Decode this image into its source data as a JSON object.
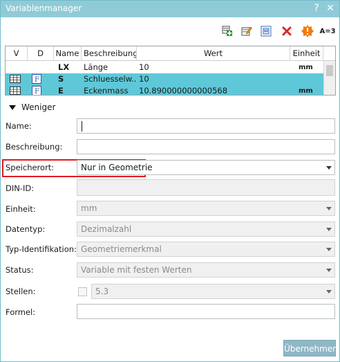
{
  "window": {
    "title": "Variablenmanager"
  },
  "titlebar_buttons": {
    "help": "?",
    "close": "✕"
  },
  "toolbar": {
    "icons": [
      "add-variable-icon",
      "edit-icon",
      "copy-icon",
      "delete-icon",
      "warning-icon",
      "assign-icon"
    ],
    "assign_label": "A=3"
  },
  "table": {
    "headers": [
      "V",
      "D",
      "Name",
      "Beschreibung",
      "Wert",
      "Einheit"
    ],
    "rows": [
      {
        "v": "",
        "d": "",
        "name": "LX",
        "beschreibung": "Länge",
        "wert": "10",
        "einheit": "mm",
        "d_icon": ""
      },
      {
        "v": "table-icon",
        "d": "F",
        "name": "S",
        "beschreibung": "Schluesselw...",
        "wert": "10",
        "einheit": "",
        "d_icon": "formula-icon"
      },
      {
        "v": "table-icon",
        "d": "F",
        "name": "E",
        "beschreibung": "Eckenmass",
        "wert": "10.890000000000568",
        "einheit": "mm",
        "d_icon": "formula-icon"
      }
    ]
  },
  "toggle": {
    "label": "Weniger"
  },
  "form": {
    "name": {
      "label": "Name:",
      "value": ""
    },
    "beschreibung": {
      "label": "Beschreibung:",
      "value": ""
    },
    "speicherort": {
      "label": "Speicherort:",
      "value": "Nur in Geometrie"
    },
    "din_id": {
      "label": "DIN-ID:",
      "value": ""
    },
    "einheit": {
      "label": "Einheit:",
      "value": "mm"
    },
    "datentyp": {
      "label": "Datentyp:",
      "value": "Dezimalzahl"
    },
    "typ_ident": {
      "label": "Typ-Identifikation:",
      "value": "Geometriemerkmal"
    },
    "status": {
      "label": "Status:",
      "value": "Variable mit festen Werten"
    },
    "stellen": {
      "label": "Stellen:",
      "value": "5.3"
    },
    "formel": {
      "label": "Formel:",
      "value": ""
    }
  },
  "actions": {
    "apply": "Übernehmen"
  },
  "colors": {
    "titlebar": "#8fcbd7",
    "selection": "#5ec8d8",
    "highlight_border": "#e0191f",
    "button": "#8fb7c6"
  }
}
